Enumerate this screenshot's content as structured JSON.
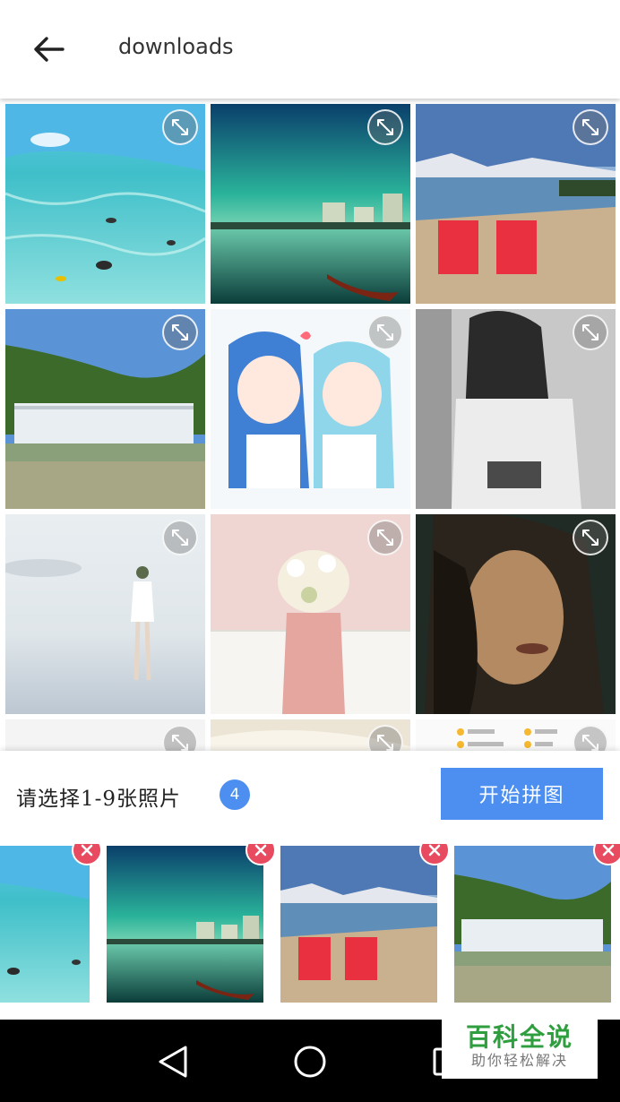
{
  "header": {
    "title": "downloads",
    "back_icon": "arrow-left-icon"
  },
  "grid": {
    "expand_icon": "expand-arrows-icon",
    "photos": [
      {
        "subject": "underwater-sea"
      },
      {
        "subject": "green-sky-city-lake"
      },
      {
        "subject": "red-chairs-lake"
      },
      {
        "subject": "waterfall"
      },
      {
        "subject": "anime-girls"
      },
      {
        "subject": "woman-grayscale"
      },
      {
        "subject": "girl-misty-beach"
      },
      {
        "subject": "girl-with-flowers"
      },
      {
        "subject": "woman-face-dark"
      },
      {
        "subject": "partial-white"
      },
      {
        "subject": "partial-paper"
      },
      {
        "subject": "partial-emoji-list"
      }
    ]
  },
  "selection": {
    "prompt": "请选择1-9张照片",
    "count": "4",
    "start_label": "开始拼图",
    "remove_icon": "close-icon",
    "selected": [
      {
        "subject": "underwater-sea"
      },
      {
        "subject": "green-sky-city-lake"
      },
      {
        "subject": "red-chairs-lake"
      },
      {
        "subject": "waterfall"
      }
    ]
  },
  "navbar": {
    "back": "nav-back-icon",
    "home": "nav-home-icon",
    "recents": "nav-recents-icon"
  },
  "watermark": {
    "title": "百科全说",
    "subtitle": "助你轻松解决"
  },
  "colors": {
    "accent": "#4d8ff0",
    "remove": "#e84a5f",
    "watermark": "#2f9e3f"
  }
}
